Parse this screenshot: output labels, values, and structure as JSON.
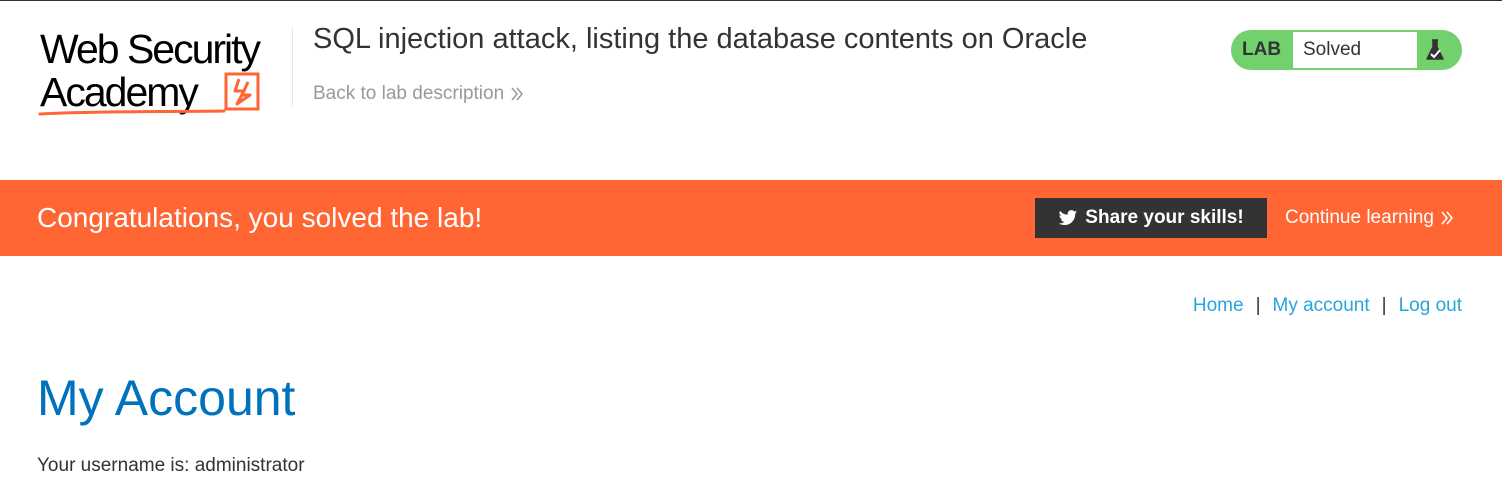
{
  "logo": {
    "line1": "Web Security",
    "line2": "Academy",
    "brand_color": "#ff6633"
  },
  "header": {
    "lab_title": "SQL injection attack, listing the database contents on Oracle",
    "back_link": "Back to lab description",
    "back_icon": "double-chevron-right-icon"
  },
  "lab_status": {
    "tag": "LAB",
    "state": "Solved",
    "icon": "flask-icon",
    "color": "#70d16d"
  },
  "banner": {
    "message": "Congratulations, you solved the lab!",
    "share_label": "Share your skills!",
    "share_icon": "twitter-icon",
    "continue_label": "Continue learning",
    "background": "#ff6633"
  },
  "nav": {
    "home": "Home",
    "account": "My account",
    "logout": "Log out",
    "separator": "|",
    "link_color": "#29a5dd"
  },
  "content": {
    "title": "My Account",
    "username_text": "Your username is: administrator",
    "title_color": "#0071bc"
  }
}
